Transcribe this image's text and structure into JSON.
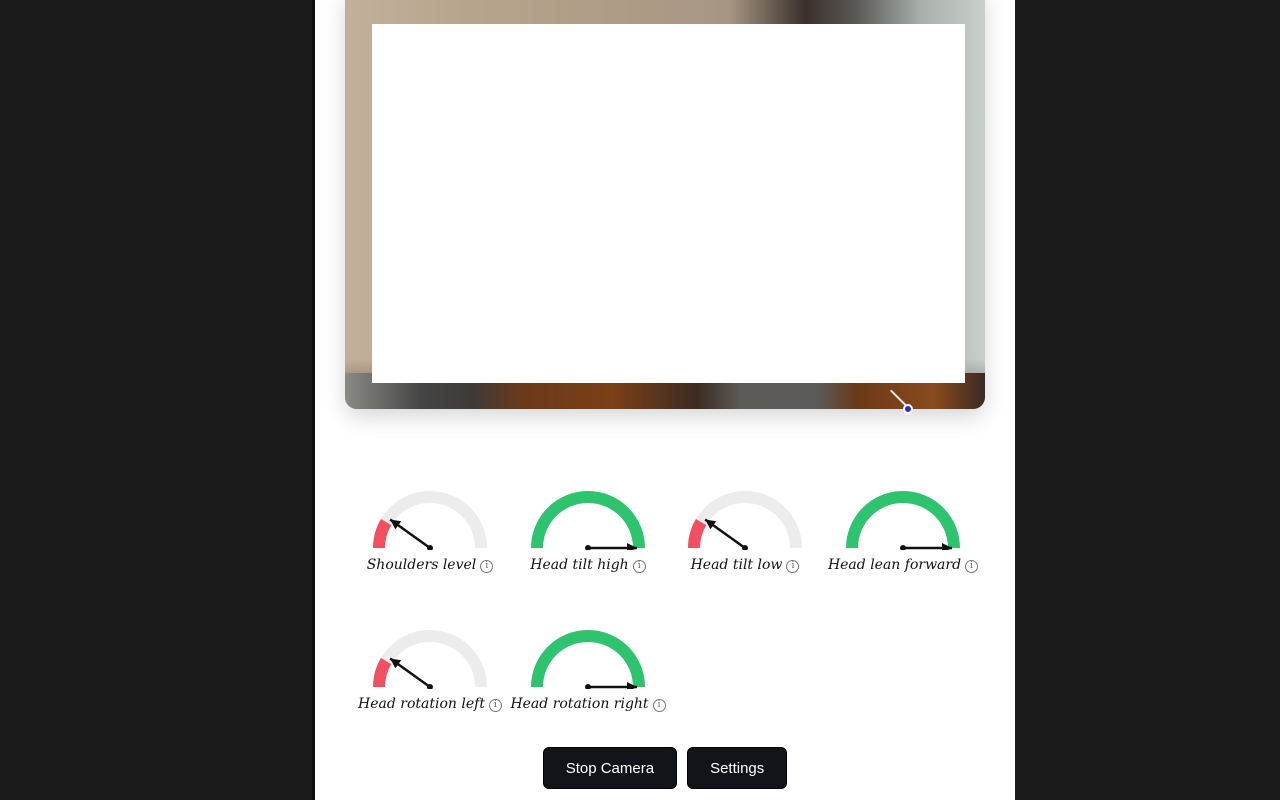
{
  "video": {
    "overlay_color": "#ffffff",
    "landmark_color": "#2a2ad8"
  },
  "colors": {
    "bad": "#f25060",
    "good": "#2ec46f",
    "track": "#ececec",
    "needle": "#111111"
  },
  "gauges": [
    {
      "label": "Shoulders level",
      "value": 0.17,
      "status": "bad",
      "info_icon": "ⓘ"
    },
    {
      "label": "Head tilt high",
      "value": 1.0,
      "status": "good",
      "info_icon": "ⓘ"
    },
    {
      "label": "Head tilt low",
      "value": 0.17,
      "status": "bad",
      "info_icon": "ⓘ"
    },
    {
      "label": "Head lean forward",
      "value": 1.0,
      "status": "good",
      "info_icon": "ⓘ"
    },
    {
      "label": "Head rotation left",
      "value": 0.17,
      "status": "bad",
      "info_icon": "ⓘ"
    },
    {
      "label": "Head rotation right",
      "value": 1.0,
      "status": "good",
      "info_icon": "ⓘ"
    }
  ],
  "buttons": {
    "stop_camera": "Stop Camera",
    "settings": "Settings"
  }
}
